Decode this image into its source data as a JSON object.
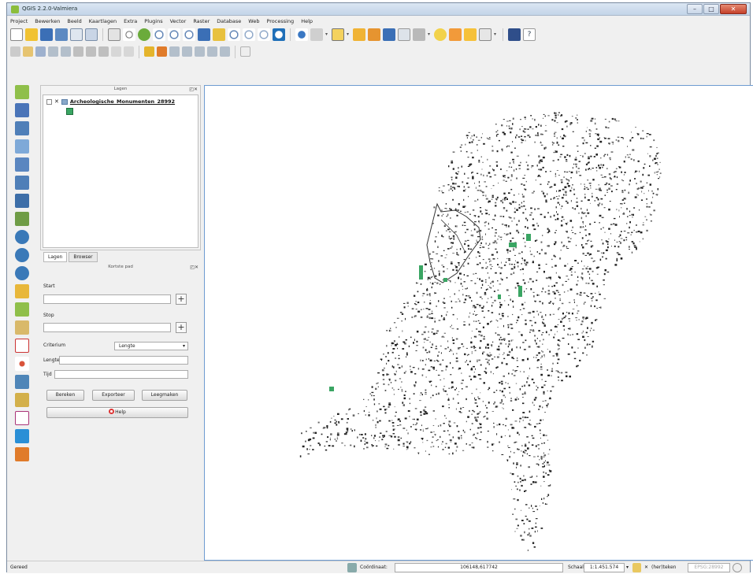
{
  "window": {
    "title": "QGIS 2.2.0-Valmiera"
  },
  "menu": [
    "Project",
    "Bewerken",
    "Beeld",
    "Kaartlagen",
    "Extra",
    "Plugins",
    "Vector",
    "Raster",
    "Database",
    "Web",
    "Processing",
    "Help"
  ],
  "layers_panel": {
    "title": "Lagen",
    "layer_name": "Archeologische_Monumenten_28992",
    "layer_color": "#3aa563"
  },
  "panel_tabs": [
    "Lagen",
    "Browser"
  ],
  "shortest_path": {
    "title": "Kortste pad",
    "start_label": "Start",
    "start_value": "",
    "stop_label": "Stop",
    "stop_value": "",
    "criterion_label": "Criterium",
    "criterion_value": "Lengte",
    "length_label": "Lengte",
    "length_value": "",
    "time_label": "Tijd",
    "time_value": "",
    "buttons": [
      "Bereken",
      "Exporteer",
      "Leegmaken"
    ],
    "help_label": "Help"
  },
  "status": {
    "ready": "Gereed",
    "coord_label": "Coördinaat:",
    "coord_value": "106148,617742",
    "scale_label": "Schaal",
    "scale_value": "1:1.451.574",
    "render_label": "(her)teken",
    "crs": "EPSG:28992"
  },
  "colors": {
    "monument_fill": "#3aa563",
    "map_border": "#6d9bd1"
  }
}
